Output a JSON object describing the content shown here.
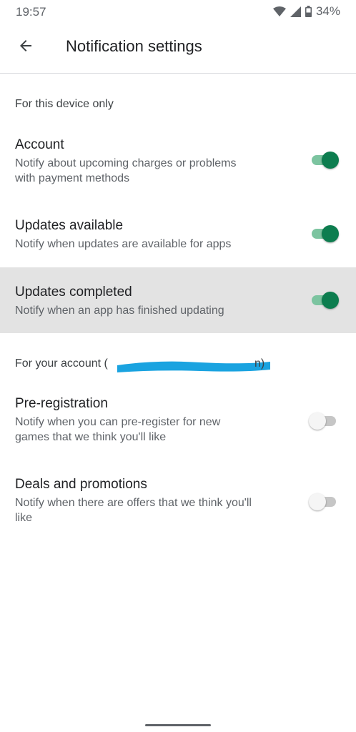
{
  "status_bar": {
    "time": "19:57",
    "battery": "34%",
    "icons": [
      "wifi-icon",
      "signal-icon",
      "battery-icon"
    ]
  },
  "app_bar": {
    "back_icon": "arrow-left-icon",
    "title": "Notification settings"
  },
  "sections": [
    {
      "header": "For this device only",
      "items": [
        {
          "title": "Account",
          "description_lines": [
            "Notify about upcoming charges or problems",
            "with payment methods"
          ],
          "enabled": true
        },
        {
          "title": "Updates available",
          "description_lines": [
            "Notify when updates are available for apps"
          ],
          "enabled": true
        },
        {
          "title": "Updates completed",
          "description_lines": [
            "Notify when an app has finished updating"
          ],
          "enabled": true,
          "highlighted": true
        }
      ]
    },
    {
      "header": "For your account (",
      "header_suffix": "n)",
      "items": [
        {
          "title": "Pre-registration",
          "description_lines": [
            "Notify when you can pre-register for new",
            "games that we think you'll like"
          ],
          "enabled": false
        },
        {
          "title": "Deals and promotions",
          "description_lines": [
            "Notify when there are offers that we think you'll",
            "like"
          ],
          "enabled": false
        }
      ]
    }
  ],
  "colors": {
    "toggle_on_thumb": "#0d7d4f",
    "toggle_on_track": "#7cc4a0",
    "toggle_off_thumb": "#f5f5f5",
    "toggle_off_track": "#c6c6c6",
    "highlight_row": "#e3e3e3",
    "redaction": "#1aa3e0"
  }
}
